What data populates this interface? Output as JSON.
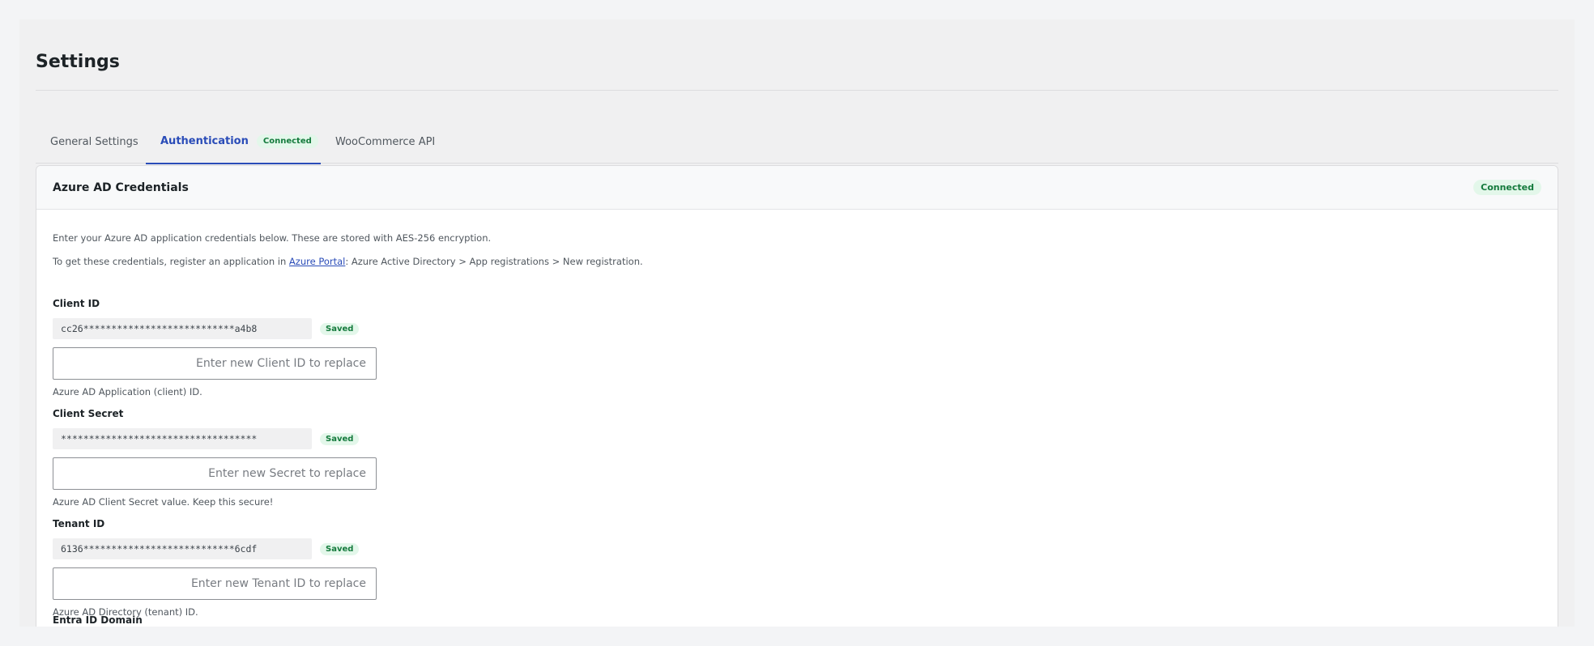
{
  "page": {
    "title": "Settings"
  },
  "tabs": [
    {
      "label": "General Settings"
    },
    {
      "label": "Authentication",
      "badge": "Connected",
      "active": true
    },
    {
      "label": "WooCommerce API"
    }
  ],
  "card": {
    "title": "Azure AD Credentials",
    "status": "Connected",
    "intro": "Enter your Azure AD application credentials below. These are stored with AES-256 encryption.",
    "register_prefix": "To get these credentials, register an application in ",
    "register_link": "Azure Portal",
    "register_suffix": ": Azure Active Directory > App registrations > New registration."
  },
  "fields": [
    {
      "label": "Client ID",
      "masked": "cc26***************************a4b8",
      "saved": "Saved",
      "placeholder": "Enter new Client ID to replace",
      "help": "Azure AD Application (client) ID."
    },
    {
      "label": "Client Secret",
      "masked": "***********************************",
      "saved": "Saved",
      "placeholder": "Enter new Secret to replace",
      "help": "Azure AD Client Secret value. Keep this secure!"
    },
    {
      "label": "Tenant ID",
      "masked": "6136***************************6cdf",
      "saved": "Saved",
      "placeholder": "Enter new Tenant ID to replace",
      "help": "Azure AD Directory (tenant) ID."
    }
  ],
  "next_field_label": "Entra ID Domain"
}
